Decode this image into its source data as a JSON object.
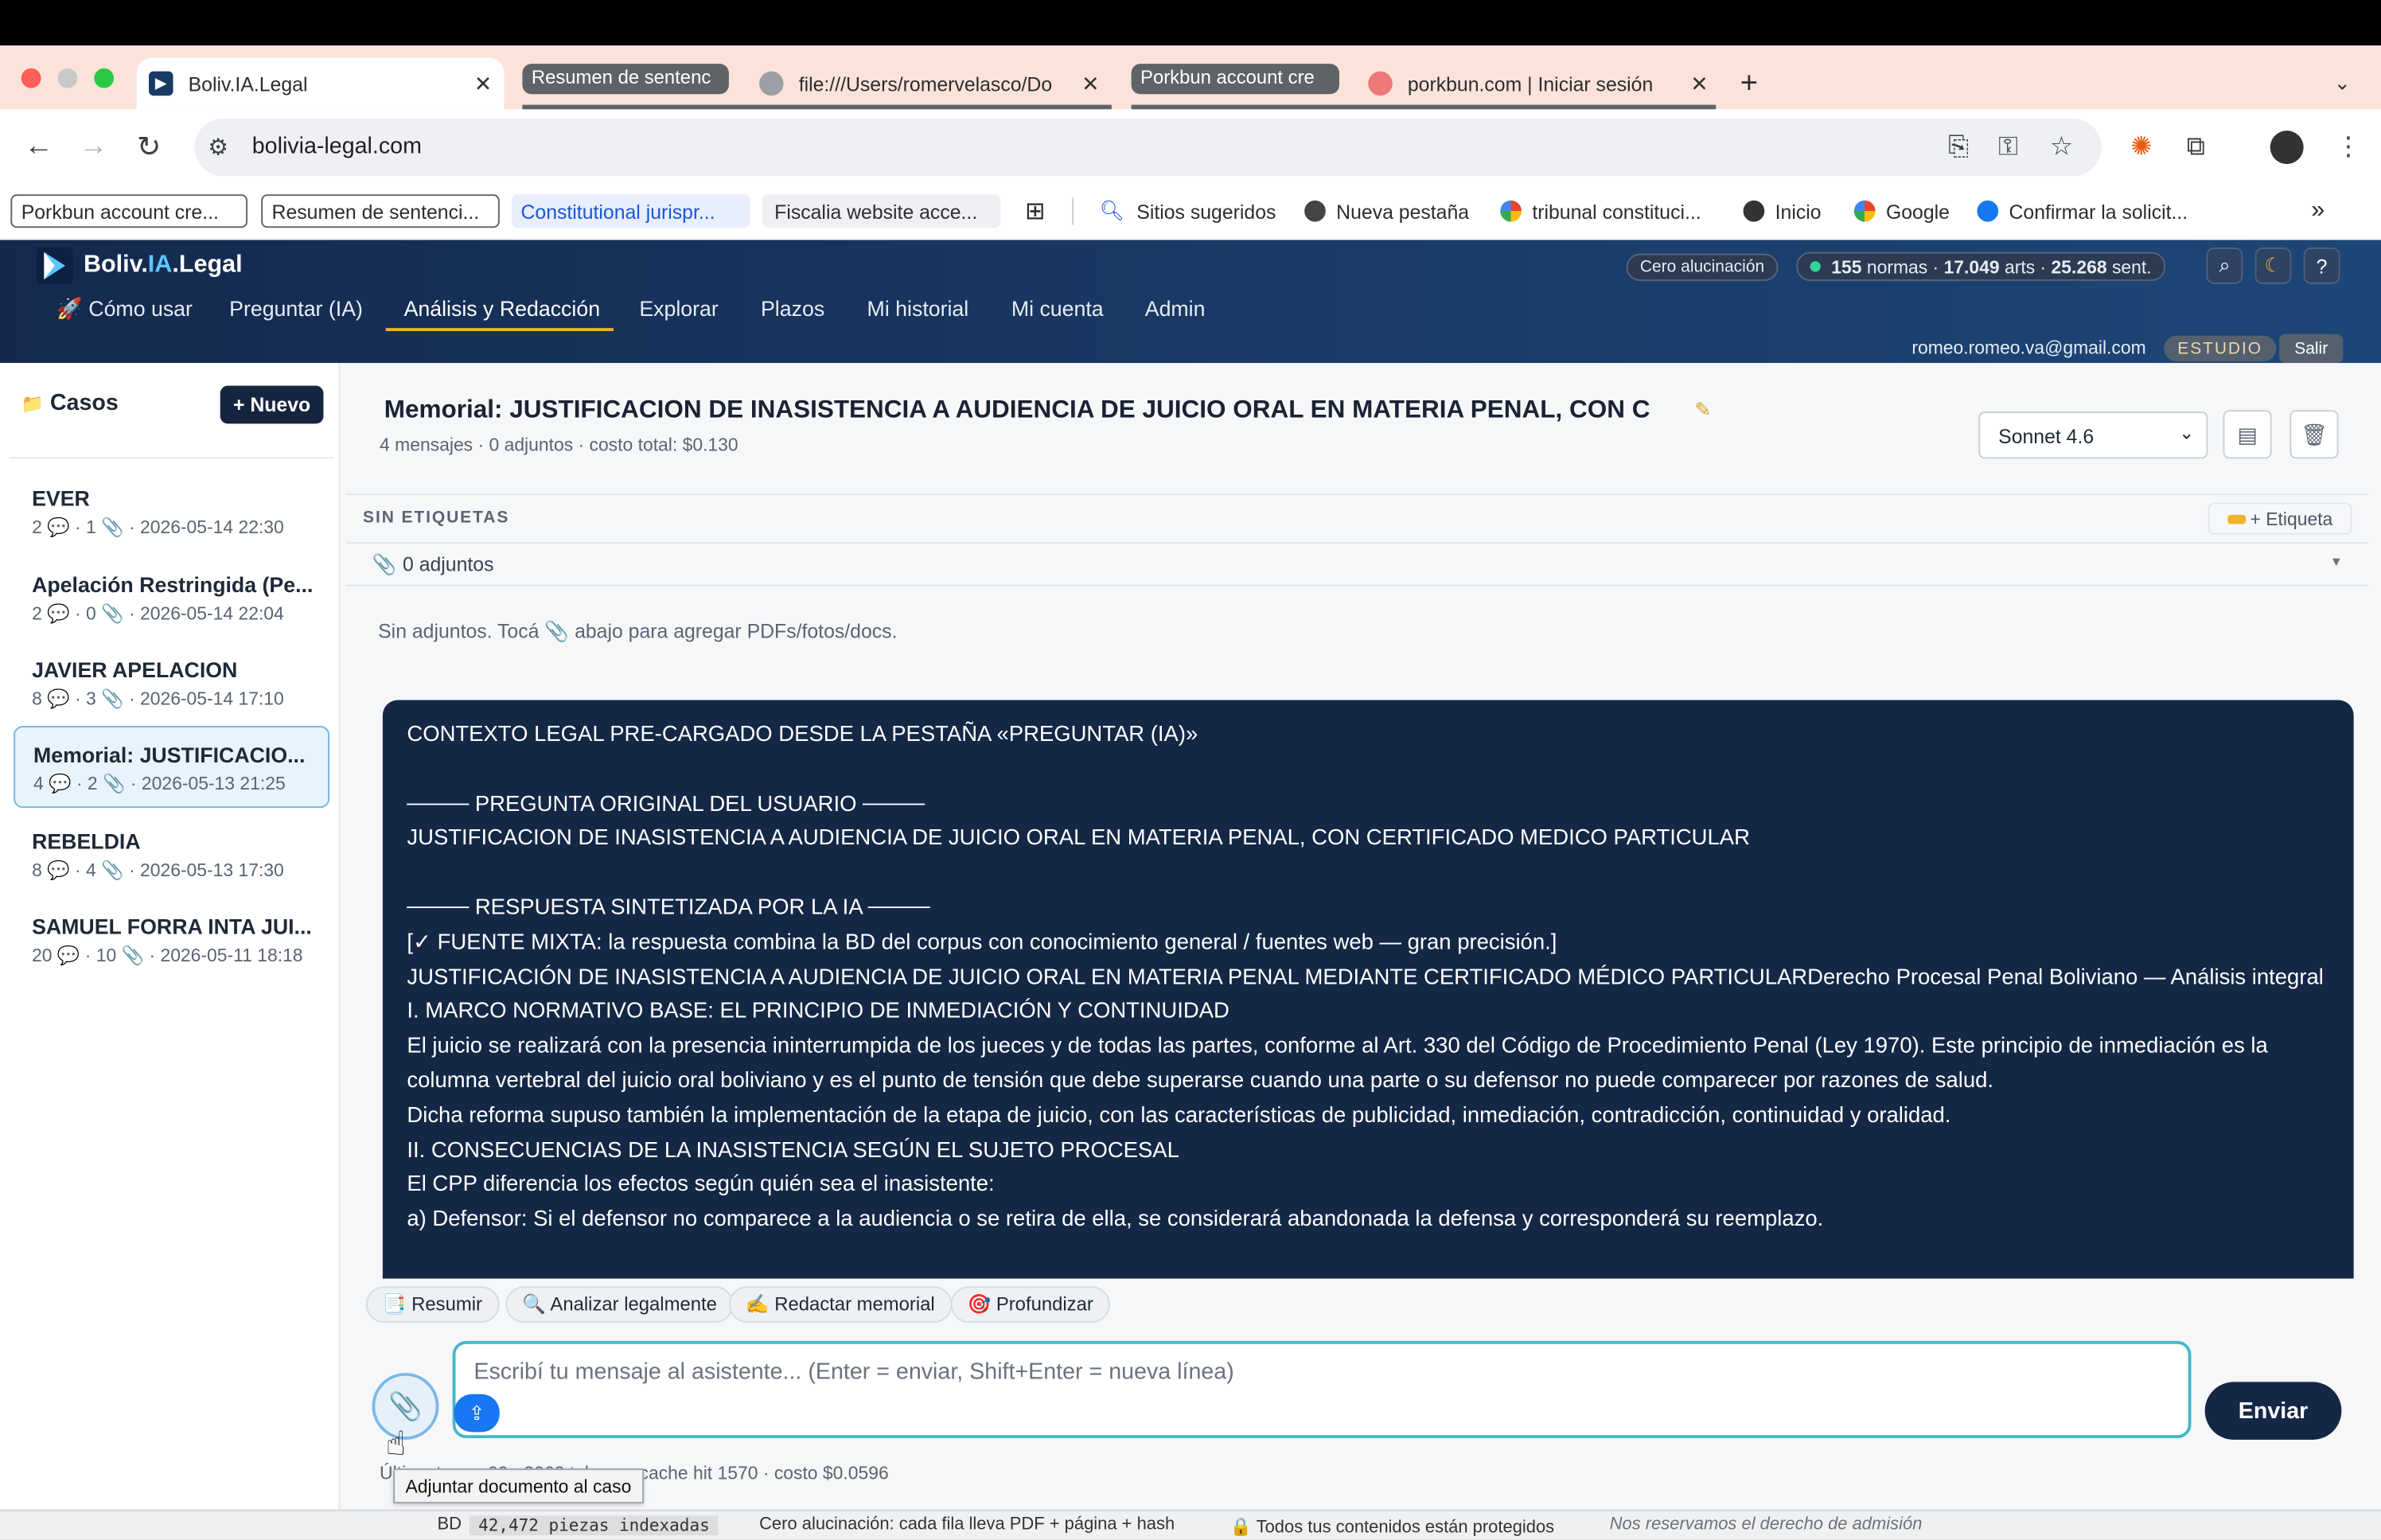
{
  "browser": {
    "tabs": [
      {
        "title": "Boliv.IA.Legal",
        "active": true
      },
      {
        "group": "Resumen de sentenc"
      },
      {
        "title": "file:///Users/romervelasco/Do"
      },
      {
        "group": "Porkbun account cre"
      },
      {
        "title": "porkbun.com | Iniciar sesión"
      }
    ],
    "new_tab": "+",
    "url": "bolivia-legal.com",
    "bookmarks": [
      "Porkbun account cre...",
      "Resumen de sentenci...",
      "Constitutional jurispr...",
      "Fiscalia website acce...",
      "Sitios sugeridos",
      "Nueva pestaña",
      "tribunal constituci...",
      "Inicio",
      "Google",
      "Confirmar la solicit..."
    ],
    "more": "»"
  },
  "app": {
    "brand_a": "Boliv.",
    "brand_b": "IA",
    "brand_c": ".Legal",
    "nav": [
      "🚀 Cómo usar",
      "Preguntar (IA)",
      "Análisis y Redacción",
      "Explorar",
      "Plazos",
      "Mi historial",
      "Mi cuenta",
      "Admin"
    ],
    "badge": "Cero alucinación",
    "stats": {
      "normas_n": "155",
      "normas": "normas ·",
      "arts_n": "17.049",
      "arts": "arts ·",
      "sent_n": "25.268",
      "sent": "sent."
    },
    "email": "romeo.romeo.va@gmail.com",
    "plan": "ESTUDIO",
    "logout": "Salir",
    "help": "?"
  },
  "sidebar": {
    "title": "Casos",
    "new": "+ Nuevo",
    "cases": [
      {
        "title": "EVER",
        "meta": "2 💬 · 1 📎 · 2026-05-14 22:30"
      },
      {
        "title": "Apelación Restringida (Pe...",
        "meta": "2 💬 · 0 📎 · 2026-05-14 22:04"
      },
      {
        "title": "JAVIER APELACION",
        "meta": "8 💬 · 3 📎 · 2026-05-14 17:10"
      },
      {
        "title": "Memorial: JUSTIFICACIO...",
        "meta": "4 💬 · 2 📎 · 2026-05-13 21:25"
      },
      {
        "title": "REBELDIA",
        "meta": "8 💬 · 4 📎 · 2026-05-13 17:30"
      },
      {
        "title": "SAMUEL FORRA INTA JUI...",
        "meta": "20 💬 · 10 📎 · 2026-05-11 18:18"
      }
    ]
  },
  "main": {
    "title": "Memorial: JUSTIFICACION DE INASISTENCIA A AUDIENCIA DE JUICIO ORAL EN MATERIA PENAL, CON C",
    "meta": "4 mensajes · 0 adjuntos · costo total: $0.130",
    "model": "Sonnet 4.6",
    "tags_label": "SIN ETIQUETAS",
    "add_tag": "+ Etiqueta",
    "attachments": "0 adjuntos",
    "no_attachments": "Sin adjuntos. Tocá 📎 abajo para agregar PDFs/fotos/docs.",
    "message_lines": [
      "CONTEXTO LEGAL PRE-CARGADO DESDE LA PESTAÑA «PREGUNTAR (IA)»",
      "",
      "──── PREGUNTA ORIGINAL DEL USUARIO ────",
      "JUSTIFICACION DE INASISTENCIA A AUDIENCIA DE JUICIO ORAL EN MATERIA PENAL, CON CERTIFICADO MEDICO PARTICULAR",
      "",
      "──── RESPUESTA SINTETIZADA POR LA IA ────",
      "[✓ FUENTE MIXTA: la respuesta combina la BD del corpus con conocimiento general / fuentes web — gran precisión.]",
      "JUSTIFICACIÓN DE INASISTENCIA A AUDIENCIA DE JUICIO ORAL EN MATERIA PENAL MEDIANTE CERTIFICADO MÉDICO PARTICULARDerecho Procesal Penal Boliviano — Análisis integral",
      "I. MARCO NORMATIVO BASE: EL PRINCIPIO DE INMEDIACIÓN Y CONTINUIDAD",
      "El juicio se realizará con la presencia ininterrumpida de los jueces y de todas las partes, conforme al Art. 330 del Código de Procedimiento Penal (Ley 1970). Este principio de inmediación es la columna vertebral del juicio oral boliviano y es el punto de tensión que debe superarse cuando una parte o su defensor no puede comparecer por razones de salud.",
      "Dicha reforma supuso también la implementación de la etapa de juicio, con las características de publicidad, inmediación, contradicción, continuidad y oralidad.",
      "II. CONSECUENCIAS DE LA INASISTENCIA SEGÚN EL SUJETO PROCESAL",
      "El CPP diferencia los efectos según quién sea el inasistente:",
      "a) Defensor: Si el defensor no comparece a la audiencia o se retira de ella, se considerará abandonada la defensa y corresponderá su reemplazo."
    ],
    "quick_actions": [
      "📑 Resumir",
      "🔍 Analizar legalmente",
      "✍️ Redactar memorial",
      "🎯 Profundizar"
    ],
    "input_placeholder": "Escribí tu mensaje al asistente... (Enter = enviar, Shift+Enter = nueva línea)",
    "send": "Enviar",
    "last_turn": "Último turno: 99 >3062 tokens · cache hit 1570 · costo $0.0596",
    "tooltip": "Adjuntar documento al caso"
  },
  "statusbar": {
    "bd": "BD",
    "count": "42,472 piezas indexadas",
    "zero": "Cero alucinación: cada fila lleva PDF + página + hash",
    "protected": "🔒 Todos tus contenidos están protegidos",
    "rights": "Nos reservamos el derecho de admisión"
  }
}
